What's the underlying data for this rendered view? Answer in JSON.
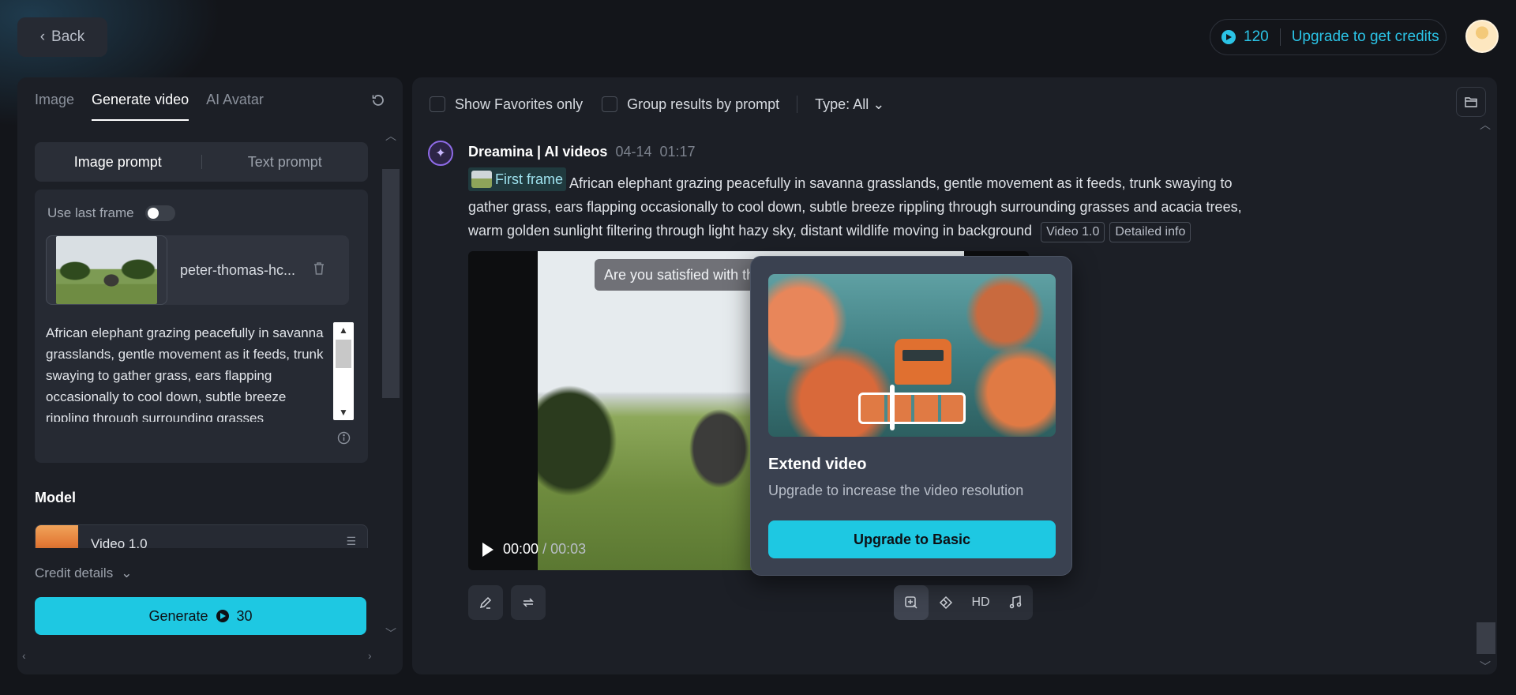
{
  "header": {
    "back_label": "Back",
    "credits": "120",
    "upgrade_label": "Upgrade to get credits"
  },
  "left": {
    "tabs": [
      {
        "label": "Image"
      },
      {
        "label": "Generate video"
      },
      {
        "label": "AI Avatar"
      }
    ],
    "prompt_modes": {
      "image": "Image prompt",
      "text": "Text prompt"
    },
    "use_last_frame_label": "Use last frame",
    "file_name": "peter-thomas-hc...",
    "prompt_text": "African elephant grazing peacefully in savanna grasslands, gentle movement as it feeds, trunk swaying to gather grass, ears flapping occasionally to cool down, subtle breeze rippling through surrounding grasses",
    "model_label": "Model",
    "model_name": "Video 1.0",
    "credit_details_label": "Credit details",
    "generate_label": "Generate",
    "generate_cost": "30"
  },
  "right": {
    "filters": {
      "favorites": "Show Favorites only",
      "group": "Group results by prompt",
      "type": "Type: All"
    },
    "message": {
      "source": "Dreamina | AI videos",
      "date": "04-14",
      "time": "01:17",
      "first_frame_label": "First frame",
      "prompt": "African elephant grazing peacefully in savanna grasslands, gentle movement as it feeds, trunk swaying to gather grass, ears flapping occasionally to cool down, subtle breeze rippling through surrounding grasses and acacia trees, warm golden sunlight filtering through light hazy sky, distant wildlife moving in background",
      "tag_model": "Video 1.0",
      "tag_detail": "Detailed info"
    },
    "video": {
      "satisfied_text": "Are you satisfied with th",
      "current_time": "00:00",
      "duration": "/ 00:03"
    },
    "tools": {
      "hd_label": "HD"
    }
  },
  "popover": {
    "title": "Extend video",
    "description": "Upgrade to increase the video resolution",
    "button_label": "Upgrade to Basic"
  },
  "colors": {
    "accent": "#1ec8e2",
    "background": "#13151a",
    "panel": "#1c1f26"
  }
}
